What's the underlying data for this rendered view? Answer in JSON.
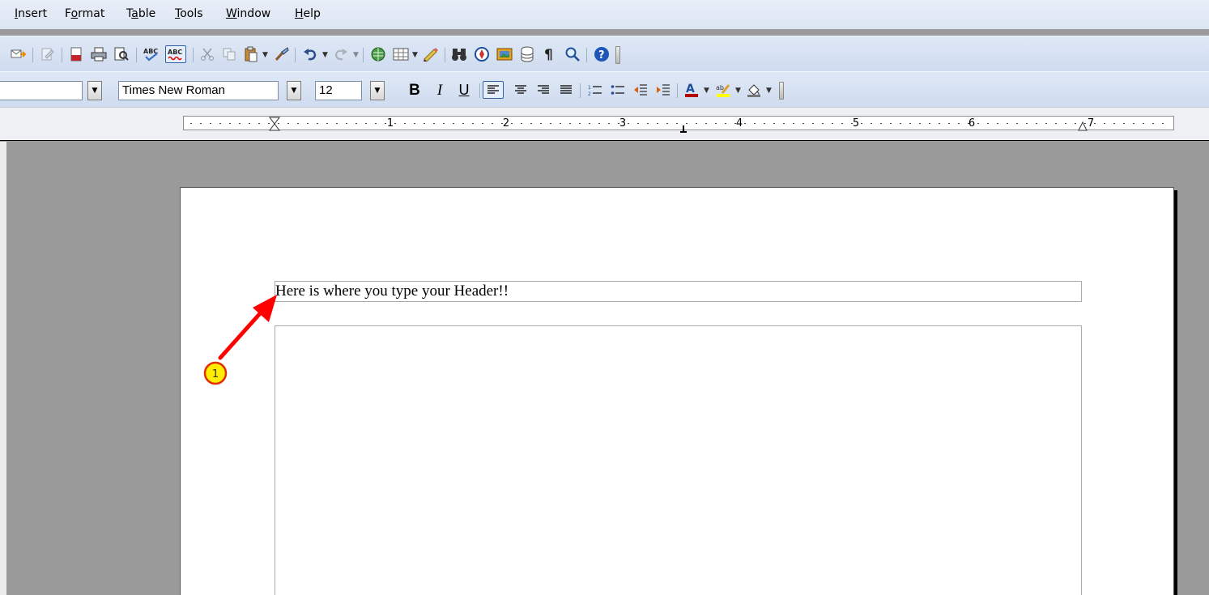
{
  "menubar": {
    "items": [
      {
        "label_pre": "",
        "label_key": "I",
        "label_post": "nsert"
      },
      {
        "label_pre": "F",
        "label_key": "o",
        "label_post": "rmat"
      },
      {
        "label_pre": "T",
        "label_key": "a",
        "label_post": "ble"
      },
      {
        "label_pre": "",
        "label_key": "T",
        "label_post": "ools"
      },
      {
        "label_pre": "",
        "label_key": "W",
        "label_post": "indow"
      },
      {
        "label_pre": "",
        "label_key": "H",
        "label_post": "elp"
      }
    ]
  },
  "format_toolbar": {
    "style_value": "",
    "font_name": "Times New Roman",
    "font_size": "12",
    "bold_label": "B",
    "italic_label": "I",
    "underline_label": "U"
  },
  "ruler": {
    "numbers": [
      "1",
      "2",
      "3",
      "4",
      "5",
      "6",
      "7"
    ]
  },
  "document": {
    "header_text": "Here is where you type your Header!!"
  },
  "annotation": {
    "number": "1",
    "color": "#ff0000",
    "badge_fill": "#ffee00"
  },
  "colors": {
    "toolbar": "#d5e0f0",
    "workspace": "#9a9a9a",
    "page": "#ffffff"
  }
}
